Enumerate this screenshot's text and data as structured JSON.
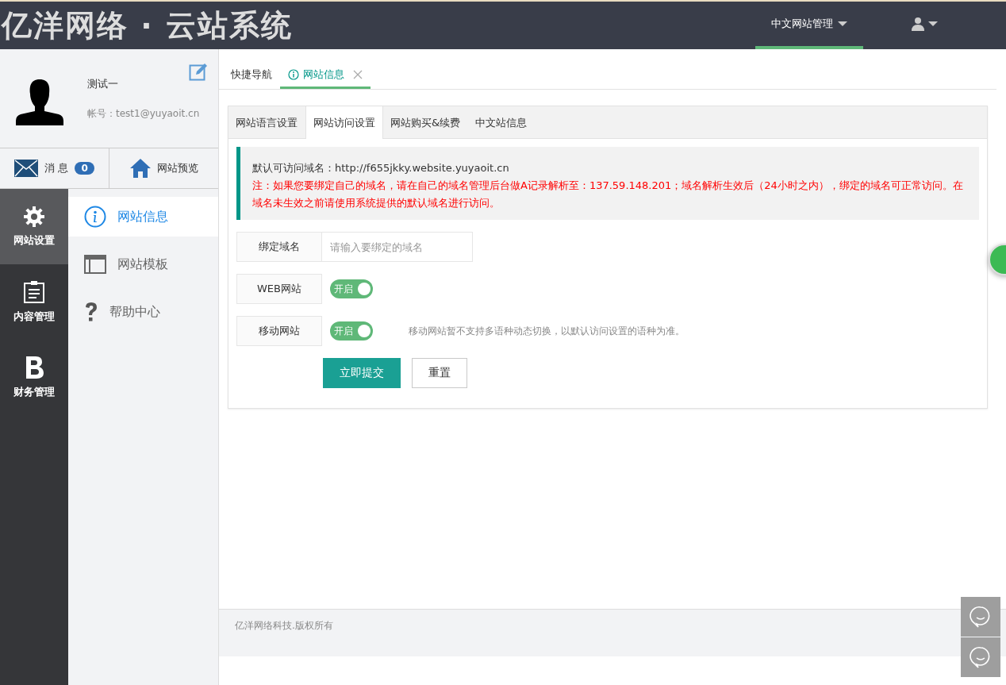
{
  "header": {
    "logo": "亿洋网络 · 云站系统",
    "menu": [
      {
        "label": "中文网站管理",
        "selected": true
      }
    ]
  },
  "profile": {
    "name": "测试一",
    "account": "帐号：test1@yuyaoit.cn"
  },
  "quick_links": [
    {
      "kind": "messages",
      "label": "消 息",
      "badge": "0"
    },
    {
      "kind": "preview",
      "label": "网站预览"
    }
  ],
  "nav": [
    {
      "kind": "gear",
      "label": "网站设置",
      "selected": true
    },
    {
      "kind": "clipboard",
      "label": "内容管理",
      "selected": false
    },
    {
      "kind": "letter",
      "label": "财务管理",
      "selected": false
    }
  ],
  "subnav": [
    {
      "kind": "info",
      "label": "网站信息",
      "selected": true
    },
    {
      "kind": "window",
      "label": "网站模板",
      "selected": false
    },
    {
      "kind": "help",
      "label": "帮助中心",
      "selected": false
    }
  ],
  "page_tabs": [
    {
      "label": "快捷导航",
      "selected": false,
      "closable": false
    },
    {
      "label": "网站信息",
      "selected": true,
      "closable": true
    }
  ],
  "card_tabs": [
    {
      "label": "网站语言设置",
      "selected": false
    },
    {
      "label": "网站访问设置",
      "selected": true
    },
    {
      "label": "网站购买&续费",
      "selected": false
    },
    {
      "label": "中文站信息",
      "selected": false
    }
  ],
  "notice": {
    "domain": "默认可访问域名：http://f655jkky.website.yuyaoit.cn",
    "warning": "注：如果您要绑定自己的域名，请在自己的域名管理后台做A记录解析至：137.59.148.201；域名解析生效后（24小时之内），绑定的域名可正常访问。在域名未生效之前请使用系统提供的默认域名进行访问。"
  },
  "domain_field": {
    "label": "绑定域名",
    "placeholder": "请输入要绑定的域名"
  },
  "toggles": [
    {
      "label": "WEB网站",
      "on": true,
      "state_text": "开启"
    },
    {
      "label": "移动网站",
      "on": true,
      "state_text": "开启",
      "hint": "移动网站暂不支持多语种动态切换，以默认访问设置的语种为准。"
    }
  ],
  "buttons": [
    {
      "kind": "primary",
      "label": "立即提交"
    },
    {
      "kind": "secondary",
      "label": "重置"
    }
  ],
  "footer": "亿洋网络科技.版权所有"
}
